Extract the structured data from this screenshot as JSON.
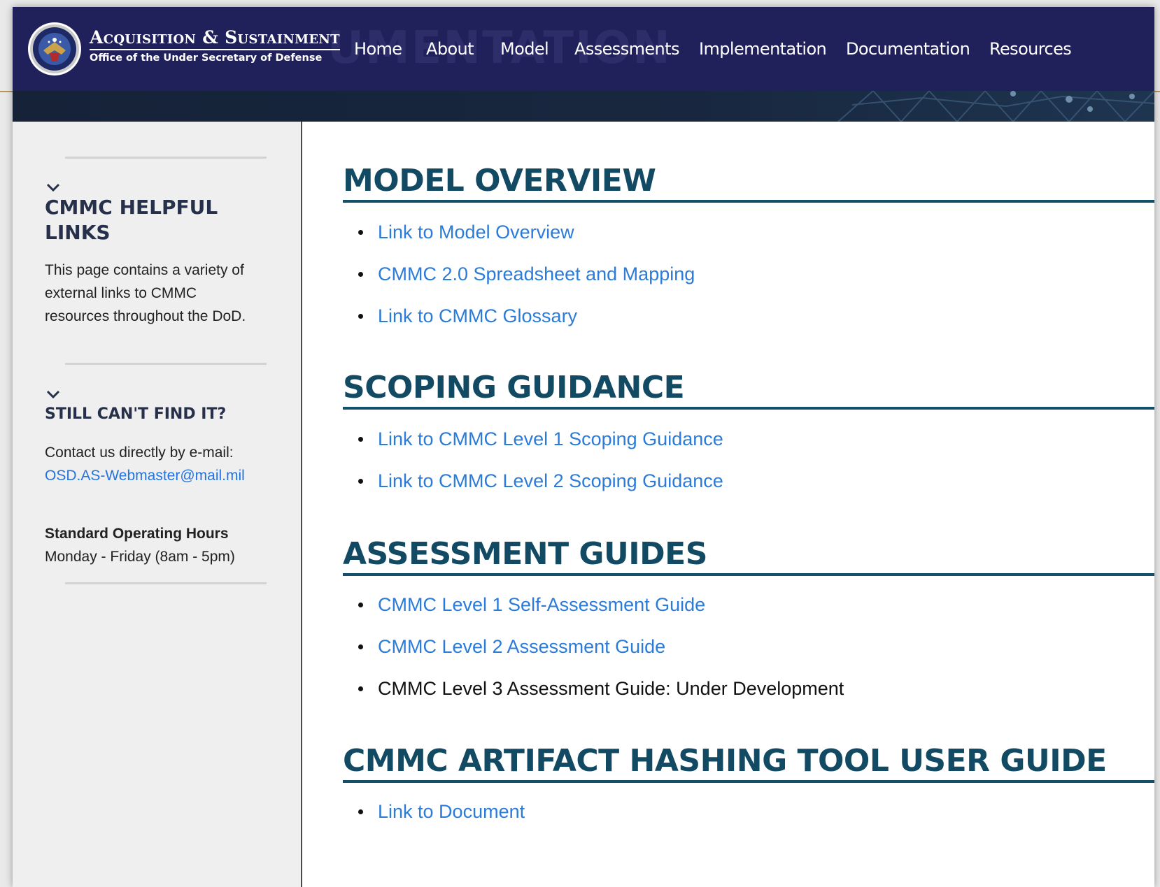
{
  "header": {
    "org_title": "Acquisition & Sustainment",
    "org_subtitle": "Office of the Under Secretary of Defense",
    "background_word": "UMENTATION",
    "nav": [
      "Home",
      "About",
      "Model",
      "Assessments",
      "Implementation",
      "Documentation",
      "Resources"
    ]
  },
  "sidebar": {
    "helpful": {
      "heading_line1": "CMMC HELPFUL",
      "heading_line2": "LINKS",
      "body": "This page contains a variety of external links to CMMC resources throughout the DoD."
    },
    "find": {
      "heading": "STILL CAN'T FIND IT?",
      "contact_text": "Contact us directly by e-mail:",
      "email": "OSD.AS-Webmaster@mail.mil",
      "hours_label": "Standard Operating Hours",
      "hours": "Monday - Friday (8am - 5pm)"
    }
  },
  "sections": [
    {
      "title": "MODEL OVERVIEW",
      "items": [
        {
          "text": "Link to Model Overview",
          "link": true
        },
        {
          "text": "CMMC 2.0 Spreadsheet and Mapping",
          "link": true
        },
        {
          "text": "Link to CMMC Glossary",
          "link": true
        }
      ]
    },
    {
      "title": "SCOPING GUIDANCE",
      "items": [
        {
          "text": "Link to CMMC Level 1 Scoping Guidance",
          "link": true
        },
        {
          "text": "Link to CMMC Level 2 Scoping Guidance",
          "link": true
        }
      ]
    },
    {
      "title": "ASSESSMENT GUIDES",
      "items": [
        {
          "text": "CMMC Level 1 Self-Assessment Guide",
          "link": true
        },
        {
          "text": "CMMC Level 2 Assessment Guide",
          "link": true
        },
        {
          "text": "CMMC Level 3 Assessment Guide: Under Development",
          "link": false
        }
      ]
    },
    {
      "title": "CMMC ARTIFACT HASHING TOOL USER GUIDE",
      "items": [
        {
          "text": "Link to Document",
          "link": true
        }
      ]
    }
  ],
  "colors": {
    "nav_background": "#20205a",
    "heading": "#134a63",
    "link": "#2b7bd8",
    "sidebar_background": "#efefef",
    "accent_gold": "#b9975b"
  }
}
